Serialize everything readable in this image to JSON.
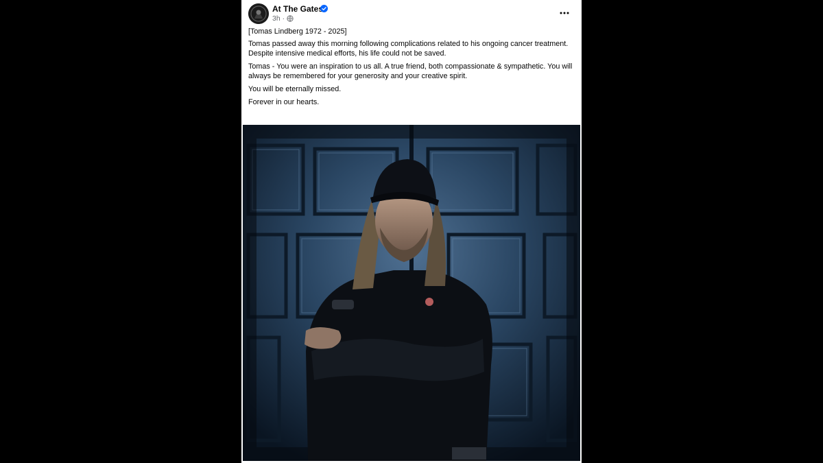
{
  "post": {
    "page_name": "At The Gates",
    "timestamp": "3h",
    "separator": "·",
    "paragraphs": {
      "title": "[Tomas Lindberg 1972 - 2025]",
      "p1_line1": "Tomas passed away this morning following complications related to his ongoing cancer treatment.",
      "p1_line2": "Despite intensive medical efforts, his life could not be saved.",
      "p2": "Tomas - You were an inspiration to us all. A true friend, both compassionate & sympathetic. You will always be remembered for your generosity and your creative spirit.",
      "p3": "You will be eternally missed.",
      "p4": "Forever in our hearts."
    },
    "icons": {
      "verified": "verified-badge-icon",
      "audience": "globe-icon",
      "more": "more-options-icon"
    }
  },
  "colors": {
    "background": "#000000",
    "card": "#ffffff",
    "text_primary": "#050505",
    "text_secondary": "#65676b",
    "verified_blue": "#0866ff"
  }
}
